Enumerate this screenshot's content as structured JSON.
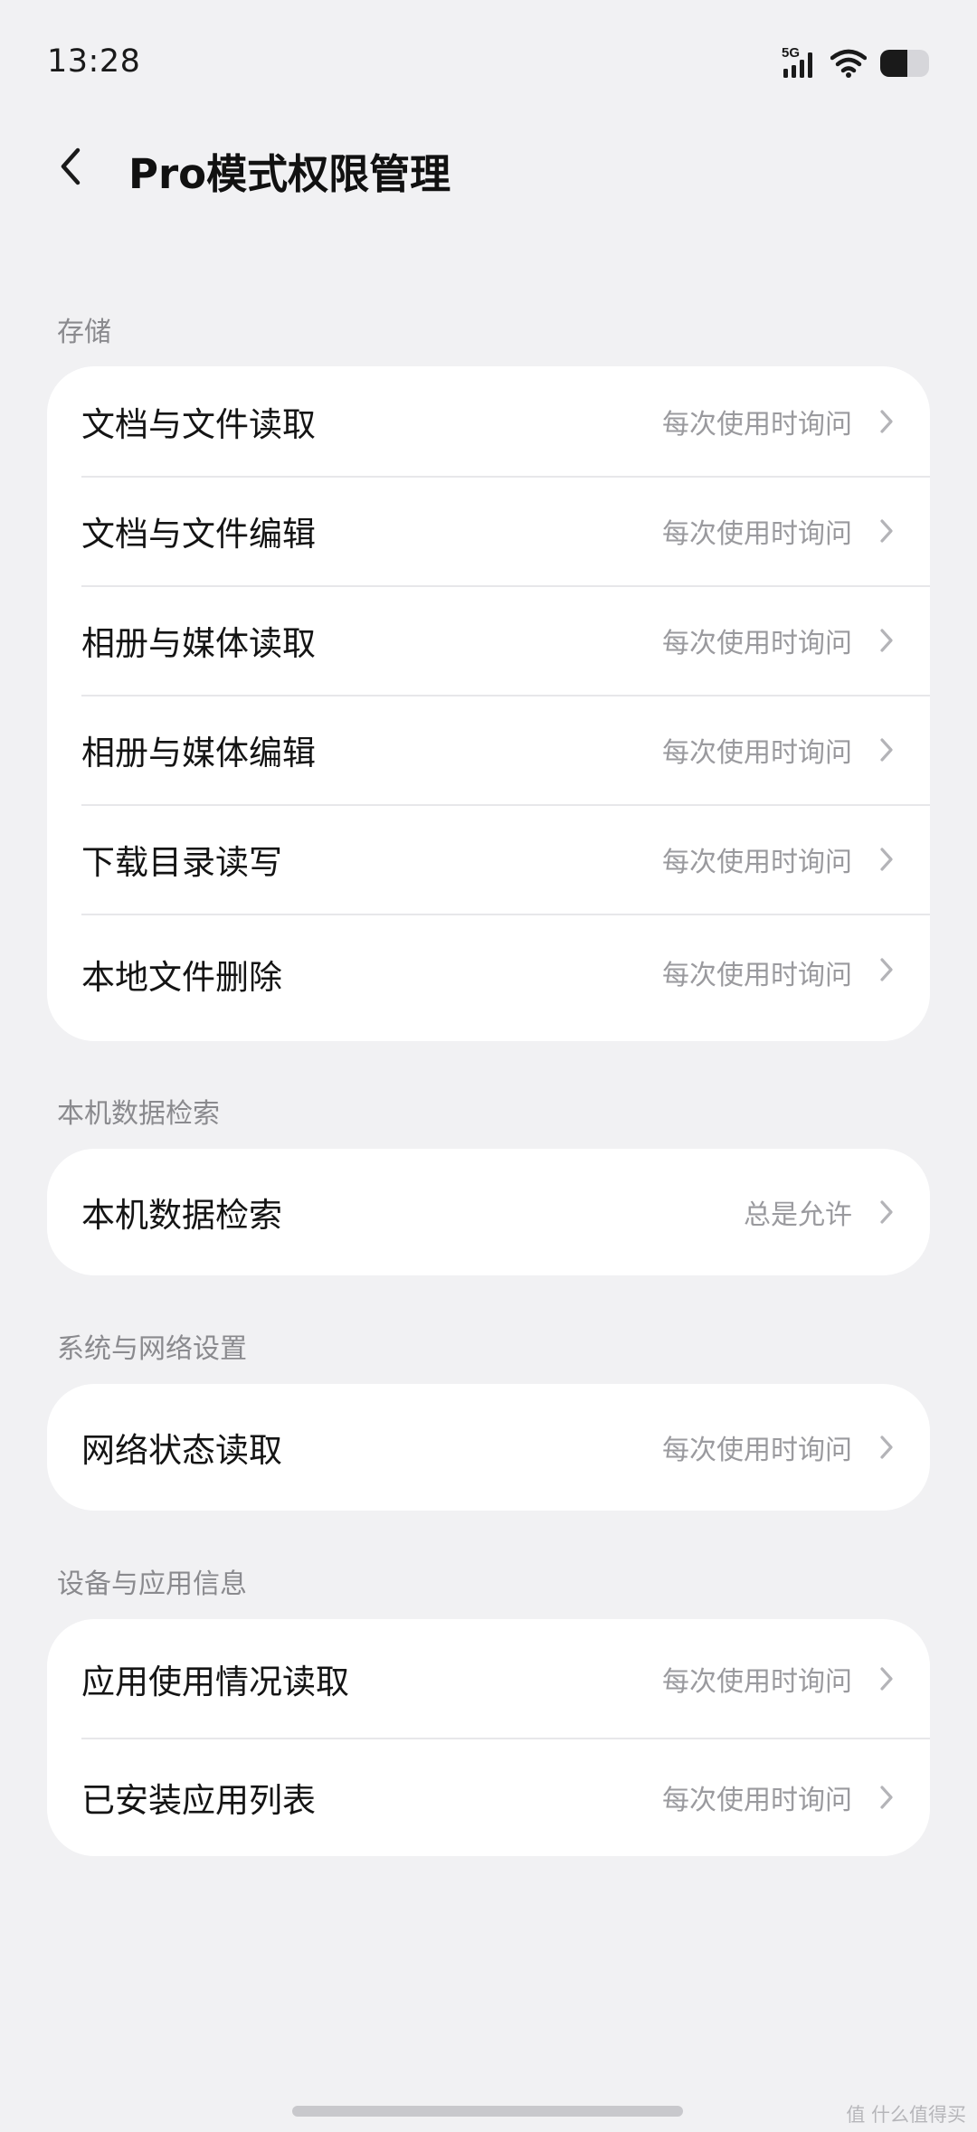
{
  "status_bar": {
    "time": "13:28",
    "network": "5G",
    "icons": [
      "signal-5g-icon",
      "wifi-icon",
      "battery-icon"
    ]
  },
  "header": {
    "back_icon": "chevron-left-icon",
    "title": "Pro模式权限管理"
  },
  "sections": [
    {
      "label": "存储",
      "items": [
        {
          "label": "文档与文件读取",
          "value": "每次使用时询问"
        },
        {
          "label": "文档与文件编辑",
          "value": "每次使用时询问"
        },
        {
          "label": "相册与媒体读取",
          "value": "每次使用时询问"
        },
        {
          "label": "相册与媒体编辑",
          "value": "每次使用时询问"
        },
        {
          "label": "下载目录读写",
          "value": "每次使用时询问"
        },
        {
          "label": "本地文件删除",
          "value": "每次使用时询问"
        }
      ]
    },
    {
      "label": "本机数据检索",
      "items": [
        {
          "label": "本机数据检索",
          "value": "总是允许"
        }
      ]
    },
    {
      "label": "系统与网络设置",
      "items": [
        {
          "label": "网络状态读取",
          "value": "每次使用时询问"
        }
      ]
    },
    {
      "label": "设备与应用信息",
      "items": [
        {
          "label": "应用使用情况读取",
          "value": "每次使用时询问"
        },
        {
          "label": "已安装应用列表",
          "value": "每次使用时询问"
        }
      ]
    }
  ],
  "watermark": "值 什么值得买",
  "colors": {
    "background": "#f1f1f3",
    "card": "#ffffff",
    "secondary_text": "#9a9a9e",
    "section_label": "#8a8a8e"
  }
}
